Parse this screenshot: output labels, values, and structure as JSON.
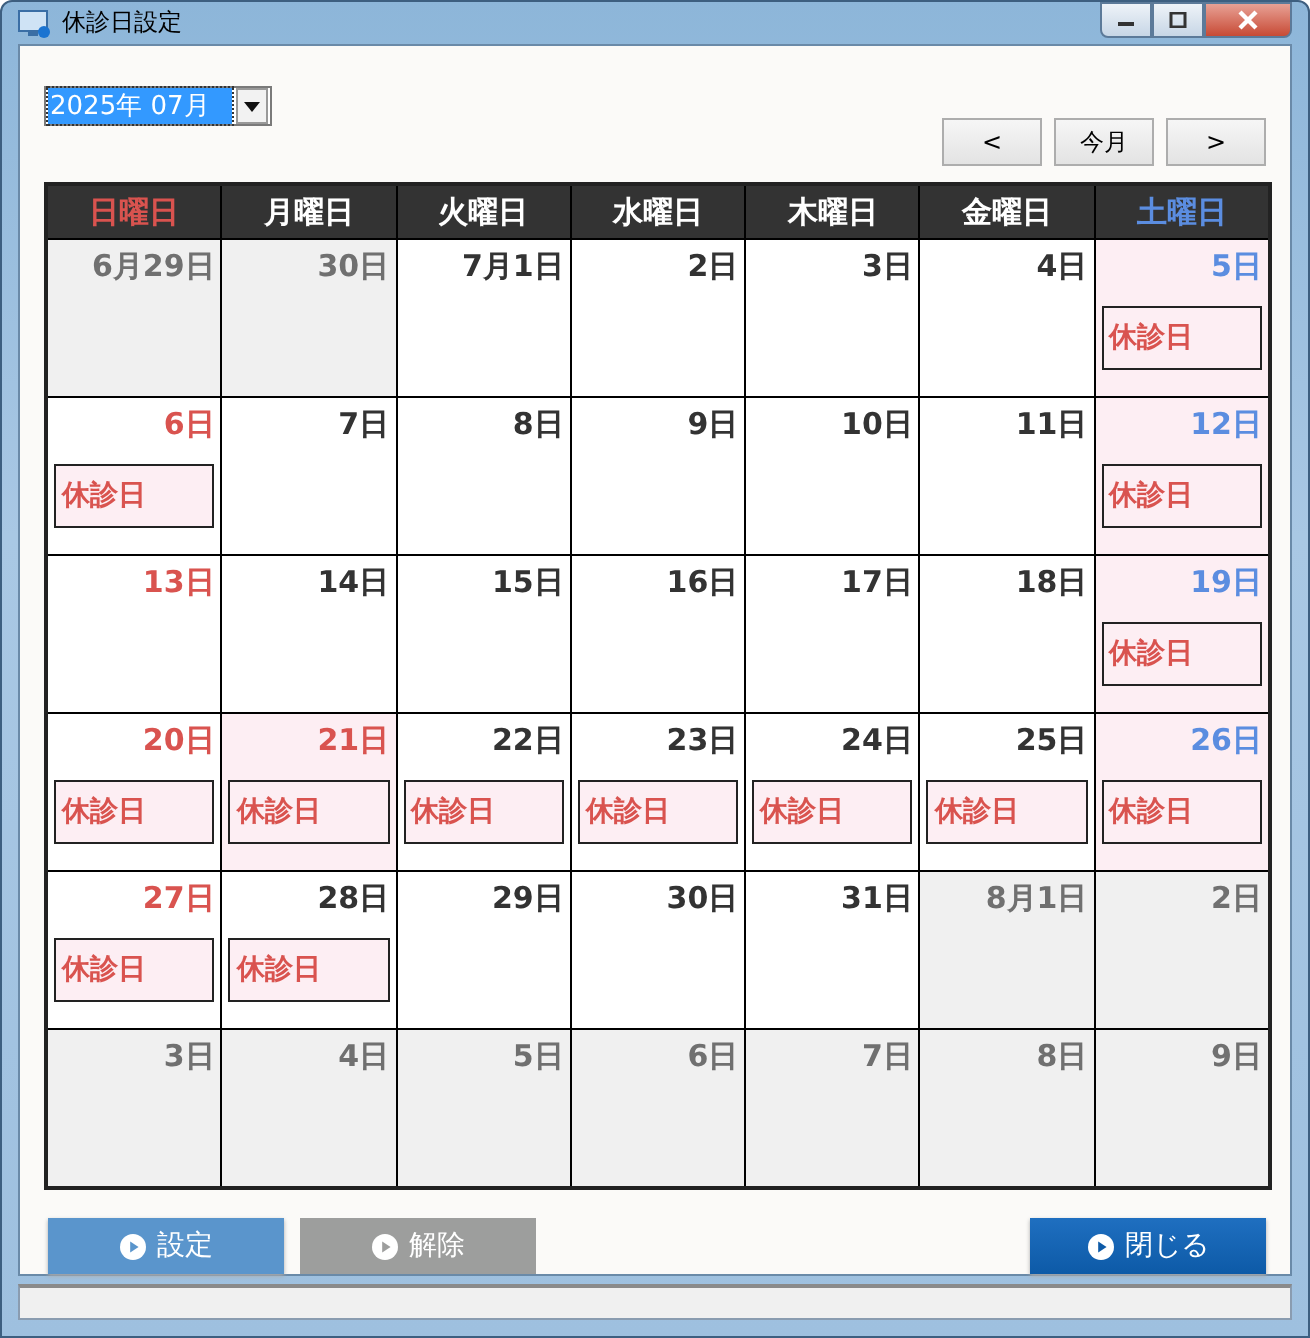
{
  "window": {
    "title": "休診日設定"
  },
  "month_select": {
    "value": "2025年 07月"
  },
  "nav_buttons": [
    "<",
    "今月",
    ">"
  ],
  "weekdays": [
    {
      "label": "日曜日",
      "kind": "sunday"
    },
    {
      "label": "月曜日",
      "kind": "weekday"
    },
    {
      "label": "火曜日",
      "kind": "weekday"
    },
    {
      "label": "水曜日",
      "kind": "weekday"
    },
    {
      "label": "木曜日",
      "kind": "weekday"
    },
    {
      "label": "金曜日",
      "kind": "weekday"
    },
    {
      "label": "土曜日",
      "kind": "saturday"
    }
  ],
  "weeks": [
    [
      {
        "day": "6月29日",
        "other_month": true
      },
      {
        "day": "30日",
        "other_month": true
      },
      {
        "day": "7月1日",
        "other_month": false,
        "holiday": false
      },
      {
        "day": "2日",
        "other_month": false,
        "holiday": false
      },
      {
        "day": "3日",
        "other_month": false,
        "holiday": false
      },
      {
        "day": "4日",
        "other_month": false,
        "holiday": false
      },
      {
        "day": "5日",
        "other_month": false,
        "holiday": false,
        "badge": "休診日"
      }
    ],
    [
      {
        "day": "6日",
        "other_month": false,
        "holiday": false,
        "badge": "休診日"
      },
      {
        "day": "7日",
        "other_month": false,
        "holiday": false
      },
      {
        "day": "8日",
        "other_month": false,
        "holiday": false
      },
      {
        "day": "9日",
        "other_month": false,
        "holiday": false
      },
      {
        "day": "10日",
        "other_month": false,
        "holiday": false
      },
      {
        "day": "11日",
        "other_month": false,
        "holiday": false
      },
      {
        "day": "12日",
        "other_month": false,
        "holiday": false,
        "badge": "休診日"
      }
    ],
    [
      {
        "day": "13日",
        "other_month": false,
        "holiday": false
      },
      {
        "day": "14日",
        "other_month": false,
        "holiday": false
      },
      {
        "day": "15日",
        "other_month": false,
        "holiday": false
      },
      {
        "day": "16日",
        "other_month": false,
        "holiday": false
      },
      {
        "day": "17日",
        "other_month": false,
        "holiday": false
      },
      {
        "day": "18日",
        "other_month": false,
        "holiday": false
      },
      {
        "day": "19日",
        "other_month": false,
        "holiday": false,
        "badge": "休診日"
      }
    ],
    [
      {
        "day": "20日",
        "other_month": false,
        "holiday": false,
        "badge": "休診日"
      },
      {
        "day": "21日",
        "other_month": false,
        "holiday": true,
        "badge": "休診日"
      },
      {
        "day": "22日",
        "other_month": false,
        "holiday": false,
        "badge": "休診日"
      },
      {
        "day": "23日",
        "other_month": false,
        "holiday": false,
        "badge": "休診日"
      },
      {
        "day": "24日",
        "other_month": false,
        "holiday": false,
        "badge": "休診日"
      },
      {
        "day": "25日",
        "other_month": false,
        "holiday": false,
        "badge": "休診日"
      },
      {
        "day": "26日",
        "other_month": false,
        "holiday": false,
        "badge": "休診日"
      }
    ],
    [
      {
        "day": "27日",
        "other_month": false,
        "holiday": false,
        "badge": "休診日"
      },
      {
        "day": "28日",
        "other_month": false,
        "holiday": false,
        "badge": "休診日"
      },
      {
        "day": "29日",
        "other_month": false,
        "holiday": false
      },
      {
        "day": "30日",
        "other_month": false,
        "holiday": false
      },
      {
        "day": "31日",
        "other_month": false,
        "holiday": false
      },
      {
        "day": "8月1日",
        "other_month": true
      },
      {
        "day": "2日",
        "other_month": true
      }
    ],
    [
      {
        "day": "3日",
        "other_month": true
      },
      {
        "day": "4日",
        "other_month": true
      },
      {
        "day": "5日",
        "other_month": true
      },
      {
        "day": "6日",
        "other_month": true
      },
      {
        "day": "7日",
        "other_month": true
      },
      {
        "day": "8日",
        "other_month": true
      },
      {
        "day": "9日",
        "other_month": true
      }
    ]
  ],
  "actions": [
    {
      "label": "設定",
      "kind": "primary",
      "disabled": false
    },
    {
      "label": "解除",
      "kind": "primary",
      "disabled": true
    },
    {
      "label": "閉じる",
      "kind": "close",
      "disabled": false
    }
  ]
}
